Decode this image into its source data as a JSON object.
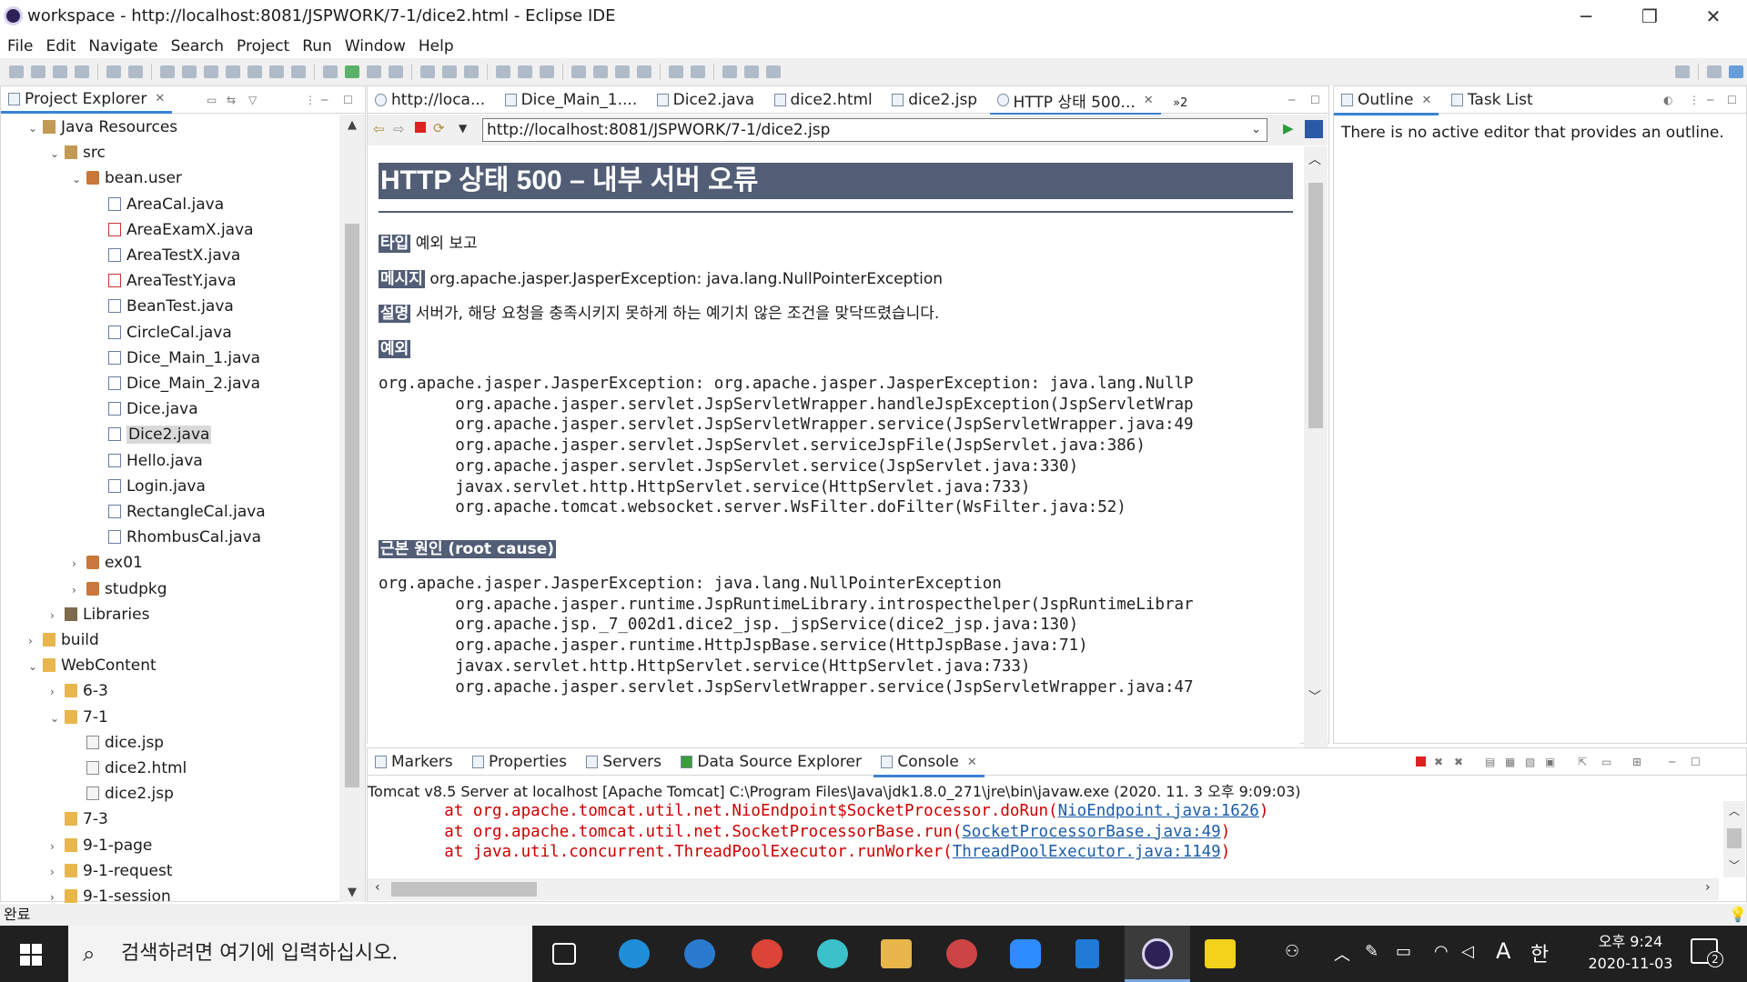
{
  "window": {
    "title": "workspace - http://localhost:8081/JSPWORK/7-1/dice2.html - Eclipse IDE",
    "controls": [
      "─",
      "❐",
      "✕"
    ]
  },
  "menu": [
    "File",
    "Edit",
    "Navigate",
    "Search",
    "Project",
    "Run",
    "Window",
    "Help"
  ],
  "project_explorer": {
    "title": "Project Explorer",
    "items": [
      {
        "label": "Java Resources",
        "indent": 1,
        "expanded": true,
        "icon": "src"
      },
      {
        "label": "src",
        "indent": 2,
        "expanded": true,
        "icon": "src"
      },
      {
        "label": "bean.user",
        "indent": 3,
        "expanded": true,
        "icon": "pkg"
      },
      {
        "label": "AreaCal.java",
        "indent": 4,
        "icon": "jfile"
      },
      {
        "label": "AreaExamX.java",
        "indent": 4,
        "icon": "jfile-err"
      },
      {
        "label": "AreaTestX.java",
        "indent": 4,
        "icon": "jfile"
      },
      {
        "label": "AreaTestY.java",
        "indent": 4,
        "icon": "jfile-err"
      },
      {
        "label": "BeanTest.java",
        "indent": 4,
        "icon": "jfile"
      },
      {
        "label": "CircleCal.java",
        "indent": 4,
        "icon": "jfile"
      },
      {
        "label": "Dice_Main_1.java",
        "indent": 4,
        "icon": "jfile"
      },
      {
        "label": "Dice_Main_2.java",
        "indent": 4,
        "icon": "jfile"
      },
      {
        "label": "Dice.java",
        "indent": 4,
        "icon": "jfile"
      },
      {
        "label": "Dice2.java",
        "indent": 4,
        "icon": "jfile",
        "selected": true
      },
      {
        "label": "Hello.java",
        "indent": 4,
        "icon": "jfile"
      },
      {
        "label": "Login.java",
        "indent": 4,
        "icon": "jfile"
      },
      {
        "label": "RectangleCal.java",
        "indent": 4,
        "icon": "jfile"
      },
      {
        "label": "RhombusCal.java",
        "indent": 4,
        "icon": "jfile"
      },
      {
        "label": "ex01",
        "indent": 3,
        "expanded": false,
        "icon": "pkg"
      },
      {
        "label": "studpkg",
        "indent": 3,
        "expanded": false,
        "icon": "pkg"
      },
      {
        "label": "Libraries",
        "indent": 2,
        "expanded": false,
        "icon": "lib"
      },
      {
        "label": "build",
        "indent": 1,
        "expanded": false,
        "icon": "folder"
      },
      {
        "label": "WebContent",
        "indent": 1,
        "expanded": true,
        "icon": "folder"
      },
      {
        "label": "6-3",
        "indent": 2,
        "expanded": false,
        "icon": "folder"
      },
      {
        "label": "7-1",
        "indent": 2,
        "expanded": true,
        "icon": "folder"
      },
      {
        "label": "dice.jsp",
        "indent": 3,
        "icon": "jsp"
      },
      {
        "label": "dice2.html",
        "indent": 3,
        "icon": "jsp"
      },
      {
        "label": "dice2.jsp",
        "indent": 3,
        "icon": "jsp"
      },
      {
        "label": "7-3",
        "indent": 2,
        "icon": "folder"
      },
      {
        "label": "9-1-page",
        "indent": 2,
        "expanded": false,
        "icon": "folder"
      },
      {
        "label": "9-1-request",
        "indent": 2,
        "expanded": false,
        "icon": "folder"
      },
      {
        "label": "9-1-session",
        "indent": 2,
        "expanded": false,
        "icon": "folder"
      }
    ]
  },
  "editor": {
    "tabs": [
      "http://loca...",
      "Dice_Main_1....",
      "Dice2.java",
      "dice2.html",
      "dice2.jsp",
      "HTTP 상태 500..."
    ],
    "overflow": "»2",
    "url": "http://localhost:8081/JSPWORK/7-1/dice2.jsp",
    "page": {
      "heading": "HTTP 상태 500 – 내부 서버 오류",
      "type_label": "타입",
      "type_value": "예외 보고",
      "message_label": "메시지",
      "message_value": "org.apache.jasper.JasperException: java.lang.NullPointerException",
      "desc_label": "설명",
      "desc_value": "서버가, 해당 요청을 충족시키지 못하게 하는 예기치 않은 조건을 맞닥뜨렸습니다.",
      "exception_label": "예외",
      "exception_trace": [
        "org.apache.jasper.JasperException: org.apache.jasper.JasperException: java.lang.NullP",
        "\torg.apache.jasper.servlet.JspServletWrapper.handleJspException(JspServletWrap",
        "\torg.apache.jasper.servlet.JspServletWrapper.service(JspServletWrapper.java:49",
        "\torg.apache.jasper.servlet.JspServlet.serviceJspFile(JspServlet.java:386)",
        "\torg.apache.jasper.servlet.JspServlet.service(JspServlet.java:330)",
        "\tjavax.servlet.http.HttpServlet.service(HttpServlet.java:733)",
        "\torg.apache.tomcat.websocket.server.WsFilter.doFilter(WsFilter.java:52)"
      ],
      "root_cause_label": "근본 원인 (root cause)",
      "root_trace": [
        "org.apache.jasper.JasperException: java.lang.NullPointerException",
        "\torg.apache.jasper.runtime.JspRuntimeLibrary.introspecthelper(JspRuntimeLibrar",
        "\torg.apache.jsp._7_002d1.dice2_jsp._jspService(dice2_jsp.java:130)",
        "\torg.apache.jasper.runtime.HttpJspBase.service(HttpJspBase.java:71)",
        "\tjavax.servlet.http.HttpServlet.service(HttpServlet.java:733)",
        "\torg.apache.jasper.servlet.JspServletWrapper.service(JspServletWrapper.java:47"
      ]
    }
  },
  "outline": {
    "tabs": [
      "Outline",
      "Task List"
    ],
    "message": "There is no active editor that provides an outline."
  },
  "bottom": {
    "tabs": [
      "Markers",
      "Properties",
      "Servers",
      "Data Source Explorer",
      "Console"
    ],
    "console_header": "Tomcat v8.5 Server at localhost [Apache Tomcat] C:\\Program Files\\Java\\jdk1.8.0_271\\jre\\bin\\javaw.exe  (2020. 11. 3 오후 9:09:03)",
    "lines": [
      {
        "text": "\tat org.apache.tomcat.util.net.NioEndpoint$SocketProcessor.doRun(",
        "link": "NioEndpoint.java:1626",
        "end": ")"
      },
      {
        "text": "\tat org.apache.tomcat.util.net.SocketProcessorBase.run(",
        "link": "SocketProcessorBase.java:49",
        "end": ")"
      },
      {
        "text": "\tat java.util.concurrent.ThreadPoolExecutor.runWorker(",
        "link": "ThreadPoolExecutor.java:1149",
        "end": ")"
      }
    ]
  },
  "status": {
    "text": "완료"
  },
  "taskbar": {
    "search_placeholder": "검색하려면 여기에 입력하십시오.",
    "time": "오후 9:24",
    "date": "2020-11-03",
    "notifications": "2",
    "lang": "A",
    "ime": "한"
  }
}
